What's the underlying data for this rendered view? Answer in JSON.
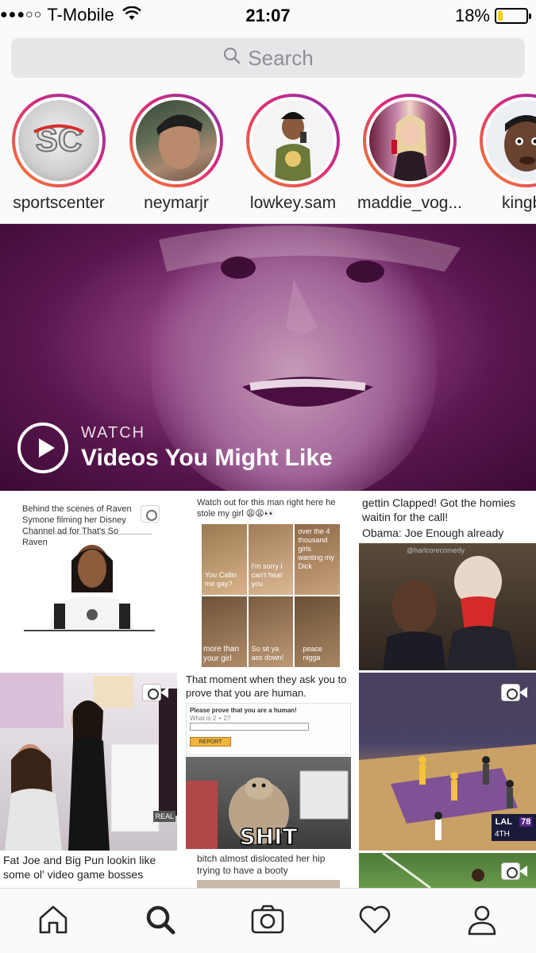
{
  "status_bar": {
    "carrier": "T-Mobile",
    "time": "21:07",
    "battery": "18%",
    "battery_level": 0.18
  },
  "search": {
    "placeholder": "Search",
    "icon": "search-icon"
  },
  "stories": [
    {
      "username": "sportscenter"
    },
    {
      "username": "neymarjr"
    },
    {
      "username": "lowkey.sam"
    },
    {
      "username": "maddie_vog..."
    },
    {
      "username": "kingba"
    }
  ],
  "hero": {
    "kicker": "WATCH",
    "title": "Videos You Might Like"
  },
  "grid": {
    "tile1_caption": "Behind the scenes of Raven Symone filming her Disney Channel ad for That's So Raven",
    "tile2_caption": "Watch out for this man right here he stole my girl 😩😩👀",
    "tile2_labels": [
      "You Callin me gay?",
      "I'm sorry I can't hear you",
      "over the 4 thousand girls wanting my Dick",
      "more than your girl",
      "So sit ya ass down!",
      "peace nigga"
    ],
    "tile3_caption_top": "gettin Clapped! Got the homies waitin for the call!",
    "tile3_caption_bottom": "Obama: Joe Enough already please",
    "tile3_credit": "@harlcorecomedy",
    "tile5_caption": "That moment when they ask you to prove that you are human.",
    "tile5_form_title": "Please prove that you are a human!",
    "tile5_form_question": "What is 2 + 2?",
    "tile5_form_button": "REPORT",
    "tile5_meme_text": "SHIT",
    "tile6_score": [
      "LAL",
      "78",
      "4TH"
    ],
    "tile7_caption": "Fat Joe and Big Pun lookin like some ol' video game bosses",
    "tile8_caption": "bitch almost dislocated her hip trying to have a booty",
    "tile4_watermark": "REAL"
  },
  "tabbar": [
    "home-icon",
    "search-icon",
    "camera-icon",
    "heart-icon",
    "profile-icon"
  ],
  "colors": {
    "story_ring_start": "#f58529",
    "story_ring_mid": "#dd2a7b",
    "story_ring_end": "#8134af",
    "hero_bg": "#5b1750",
    "battery_fill": "#ffcc00"
  }
}
